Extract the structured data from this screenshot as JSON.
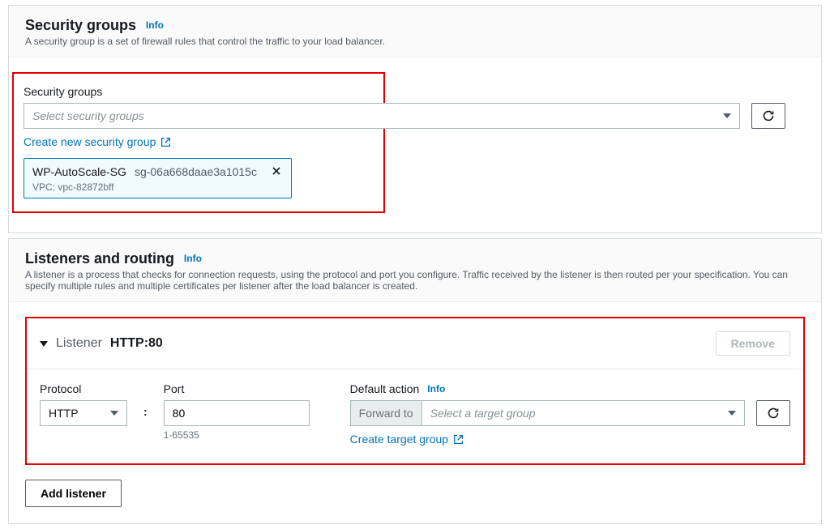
{
  "security_groups": {
    "title": "Security groups",
    "info": "Info",
    "description": "A security group is a set of firewall rules that control the traffic to your load balancer.",
    "field_label": "Security groups",
    "select_placeholder": "Select security groups",
    "create_link": "Create new security group",
    "chip": {
      "name": "WP-AutoScale-SG",
      "sg_id": "sg-06a668daae3a1015c",
      "vpc": "VPC: vpc-82872bff"
    }
  },
  "listeners": {
    "title": "Listeners and routing",
    "info": "Info",
    "description": "A listener is a process that checks for connection requests, using the protocol and port you configure. Traffic received by the listener is then routed per your specification. You can specify multiple rules and multiple certificates per listener after the load balancer is created.",
    "listener": {
      "label": "Listener",
      "value": "HTTP:80",
      "remove": "Remove",
      "protocol_label": "Protocol",
      "protocol_value": "HTTP",
      "port_label": "Port",
      "port_value": "80",
      "port_hint": "1-65535",
      "action_label": "Default action",
      "action_info": "Info",
      "forward_prefix": "Forward to",
      "target_placeholder": "Select a target group",
      "create_target": "Create target group"
    },
    "add_listener": "Add listener"
  }
}
